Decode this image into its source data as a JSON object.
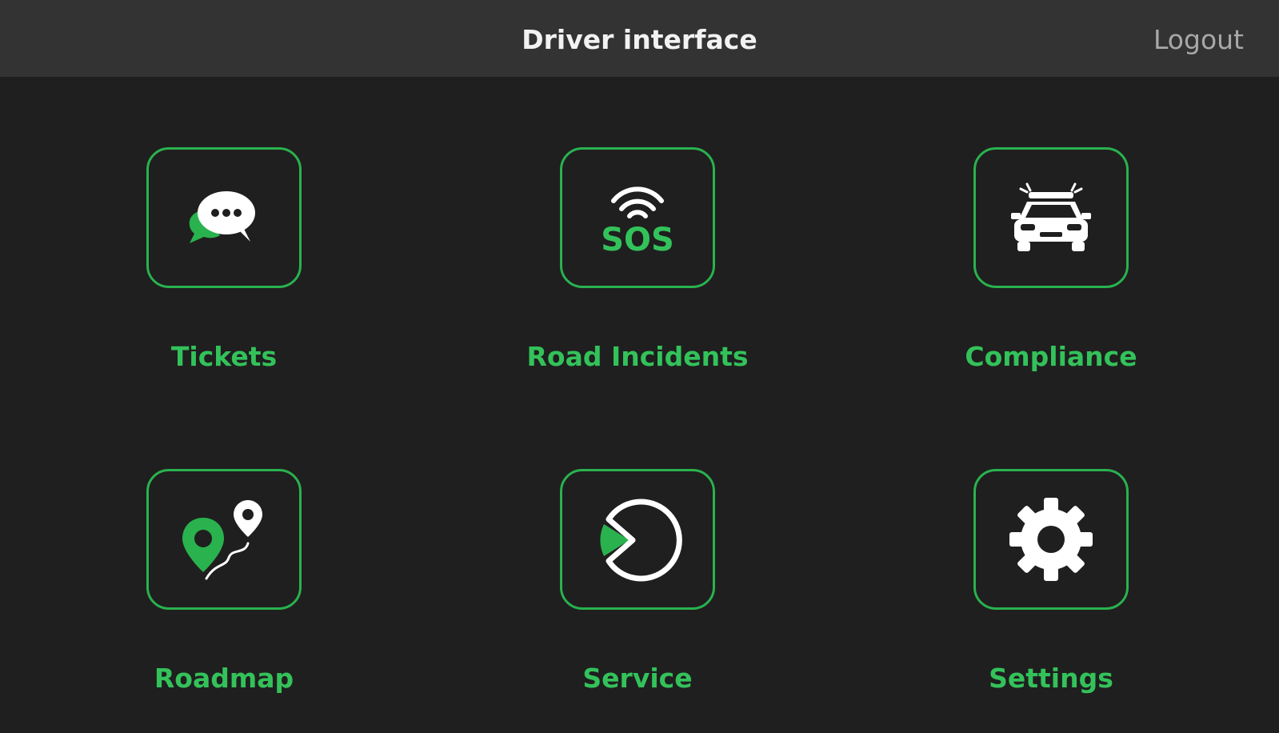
{
  "header": {
    "title": "Driver interface",
    "logout_label": "Logout"
  },
  "tiles": [
    {
      "label": "Tickets",
      "icon": "chat-bubbles-icon"
    },
    {
      "label": "Road Incidents",
      "icon": "sos-signal-icon",
      "icon_text": "SOS"
    },
    {
      "label": "Compliance",
      "icon": "police-car-icon"
    },
    {
      "label": "Roadmap",
      "icon": "route-pins-icon"
    },
    {
      "label": "Service",
      "icon": "service-pie-icon"
    },
    {
      "label": "Settings",
      "icon": "gear-icon"
    }
  ],
  "colors": {
    "background": "#1f1f1f",
    "header": "#333333",
    "accent": "#29b24e",
    "icon_white": "#ffffff",
    "logout": "#a8a8a8"
  }
}
